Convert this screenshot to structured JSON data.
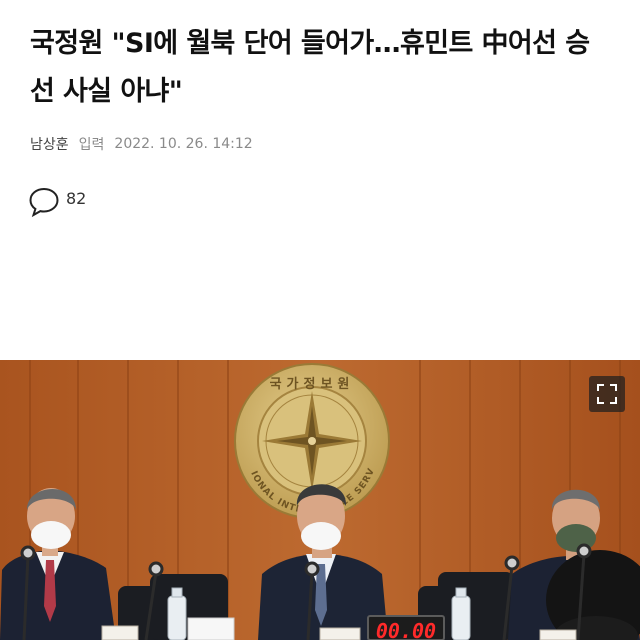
{
  "article": {
    "headline_line1": "국정원 \"SI에 월북 단어 들어가…휴민트 中어선 승",
    "headline_line2": "선 사실 아냐\"",
    "author": "남상훈",
    "date_label": "입력",
    "date": "2022. 10. 26. 14:12"
  },
  "comments": {
    "icon": "speech-bubble-icon",
    "count": "82"
  },
  "photo": {
    "emblem_top_text": "국가정보원",
    "emblem_ring_text": "NATIONAL INTELLIGENCE SERVICE",
    "clock_display": "00.00",
    "expand_icon": "fullscreen-expand-icon",
    "colors": {
      "wall_wood": "#b5612a",
      "emblem_gold": "#c9ac62",
      "clock_red": "#ff2a2a"
    }
  }
}
